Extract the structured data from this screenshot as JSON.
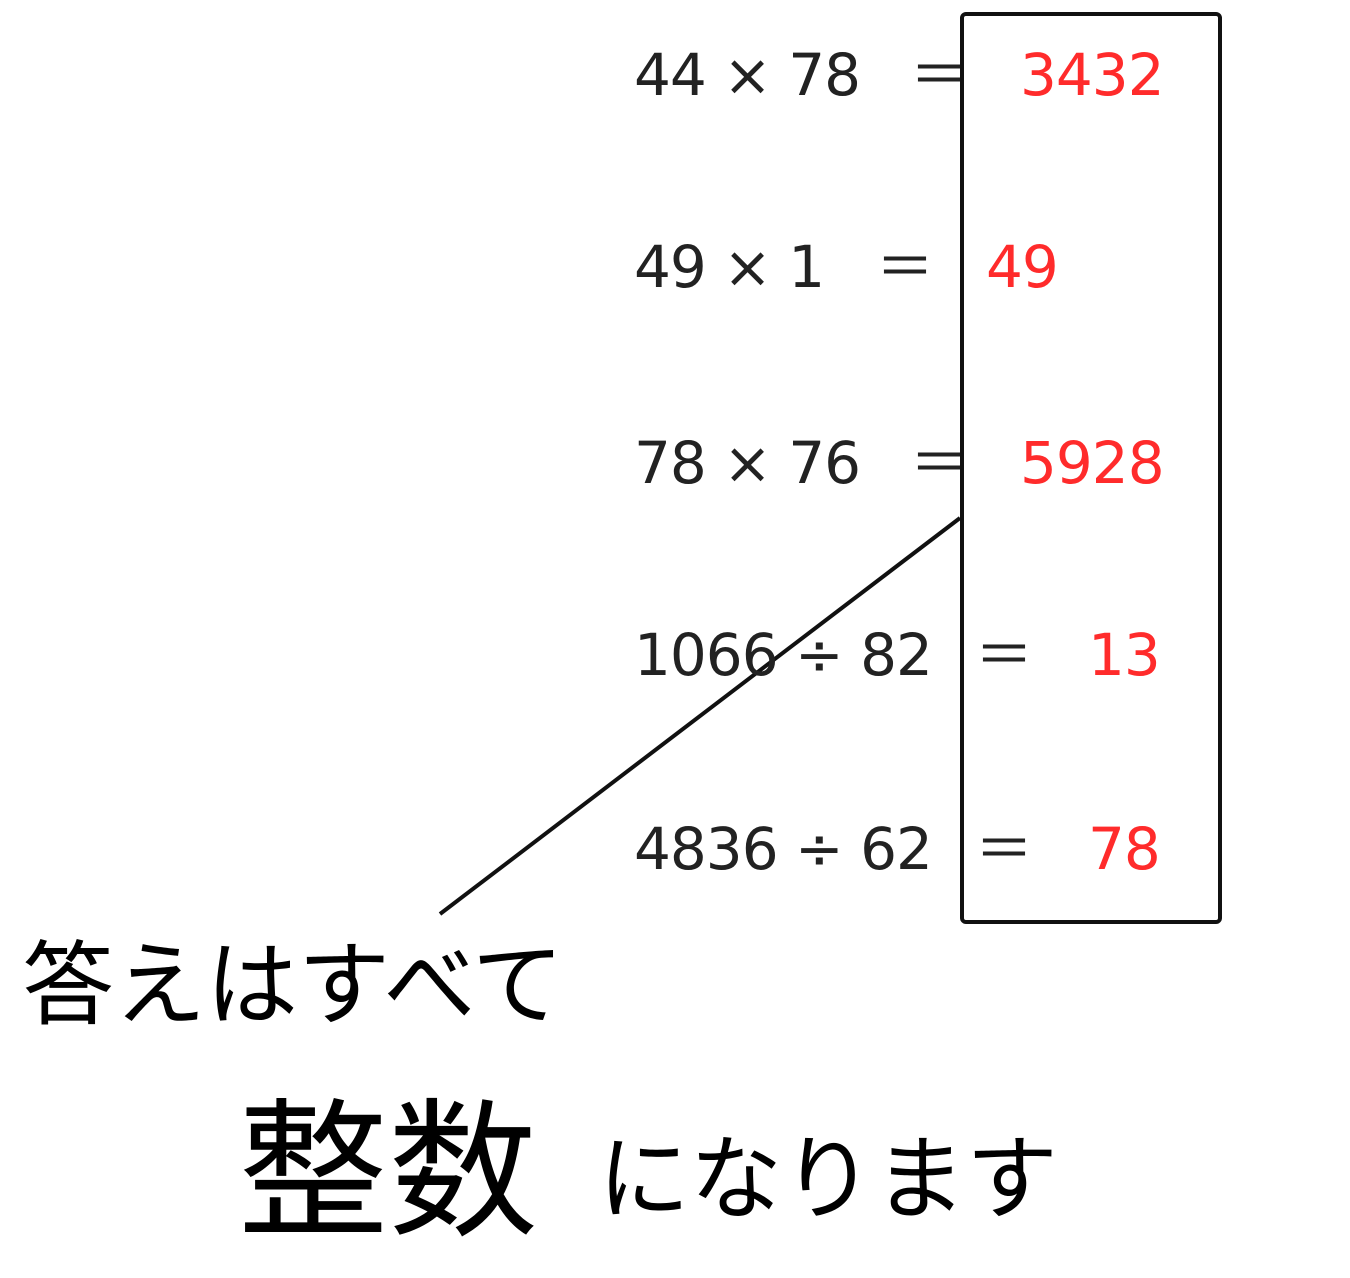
{
  "equations": [
    {
      "expression": "44 × 78",
      "equals": "＝",
      "answer": "3432"
    },
    {
      "expression": "49 × 1",
      "equals": "＝",
      "answer": "49"
    },
    {
      "expression": "78 × 76",
      "equals": "＝",
      "answer": "5928"
    },
    {
      "expression": "1066 ÷ 82",
      "equals": "＝",
      "answer": "13"
    },
    {
      "expression": "4836 ÷ 62",
      "equals": "＝",
      "answer": "78"
    }
  ],
  "note": {
    "line1": "答えはすべて",
    "emphasis": "整数",
    "suffix": "になります"
  },
  "colors": {
    "answer": "#ff2b2b",
    "text": "#222222",
    "box_border": "#111111"
  }
}
